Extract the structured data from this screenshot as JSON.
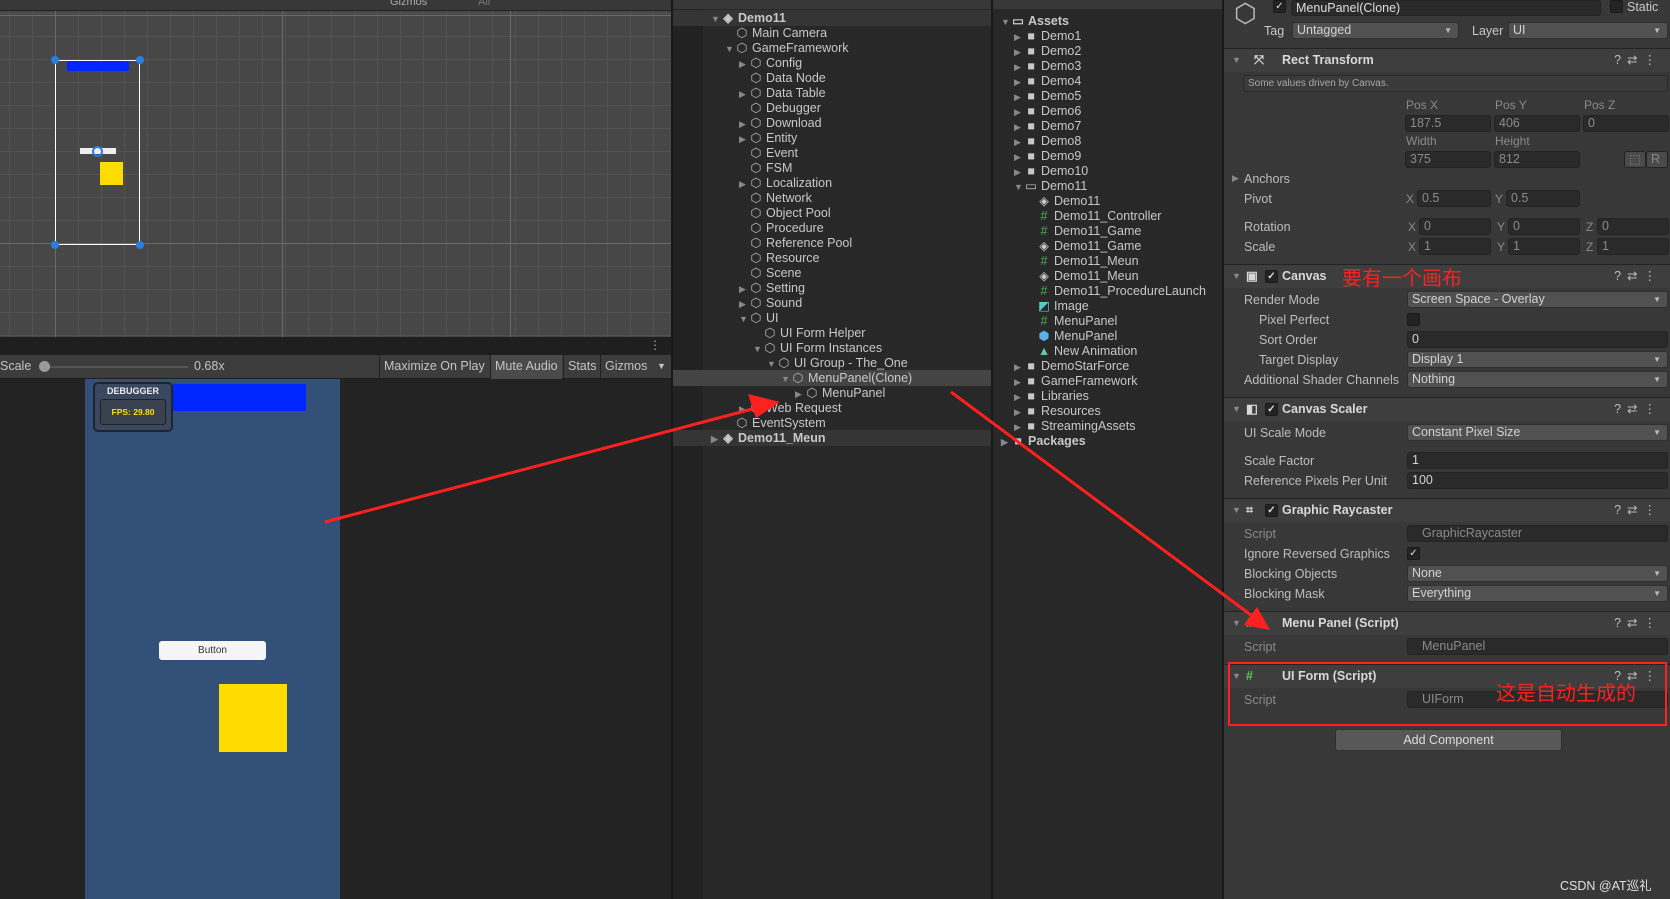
{
  "scene": {
    "toolbar": {
      "gizmos": "Gizmos",
      "search_placeholder": "All"
    }
  },
  "game_toolbar": {
    "scale_label": "Scale",
    "scale_value": "0.68x",
    "scale_fraction": 0.0,
    "maximize": "Maximize On Play",
    "mute": "Mute Audio",
    "stats": "Stats",
    "gizmos": "Gizmos"
  },
  "game": {
    "debugger_title": "DEBUGGER",
    "fps": "FPS: 29.80",
    "button_label": "Button",
    "colors": {
      "background": "#325078",
      "bar": "#0026ff",
      "square": "#ffdc00"
    }
  },
  "hierarchy": {
    "items": [
      {
        "label": "Demo11",
        "depth": 0,
        "arrow": "open",
        "icon": "scene",
        "scene": true
      },
      {
        "label": "Main Camera",
        "depth": 1,
        "arrow": "none",
        "icon": "cube"
      },
      {
        "label": "GameFramework",
        "depth": 1,
        "arrow": "open",
        "icon": "cube"
      },
      {
        "label": "Config",
        "depth": 2,
        "arrow": "closed",
        "icon": "cube"
      },
      {
        "label": "Data Node",
        "depth": 2,
        "arrow": "none",
        "icon": "cube"
      },
      {
        "label": "Data Table",
        "depth": 2,
        "arrow": "closed",
        "icon": "cube"
      },
      {
        "label": "Debugger",
        "depth": 2,
        "arrow": "none",
        "icon": "cube"
      },
      {
        "label": "Download",
        "depth": 2,
        "arrow": "closed",
        "icon": "cube"
      },
      {
        "label": "Entity",
        "depth": 2,
        "arrow": "closed",
        "icon": "cube"
      },
      {
        "label": "Event",
        "depth": 2,
        "arrow": "none",
        "icon": "cube"
      },
      {
        "label": "FSM",
        "depth": 2,
        "arrow": "none",
        "icon": "cube"
      },
      {
        "label": "Localization",
        "depth": 2,
        "arrow": "closed",
        "icon": "cube"
      },
      {
        "label": "Network",
        "depth": 2,
        "arrow": "none",
        "icon": "cube"
      },
      {
        "label": "Object Pool",
        "depth": 2,
        "arrow": "none",
        "icon": "cube"
      },
      {
        "label": "Procedure",
        "depth": 2,
        "arrow": "none",
        "icon": "cube"
      },
      {
        "label": "Reference Pool",
        "depth": 2,
        "arrow": "none",
        "icon": "cube"
      },
      {
        "label": "Resource",
        "depth": 2,
        "arrow": "none",
        "icon": "cube"
      },
      {
        "label": "Scene",
        "depth": 2,
        "arrow": "none",
        "icon": "cube"
      },
      {
        "label": "Setting",
        "depth": 2,
        "arrow": "closed",
        "icon": "cube"
      },
      {
        "label": "Sound",
        "depth": 2,
        "arrow": "closed",
        "icon": "cube"
      },
      {
        "label": "UI",
        "depth": 2,
        "arrow": "open",
        "icon": "cube"
      },
      {
        "label": "UI Form Helper",
        "depth": 3,
        "arrow": "none",
        "icon": "cube"
      },
      {
        "label": "UI Form Instances",
        "depth": 3,
        "arrow": "open",
        "icon": "cube"
      },
      {
        "label": "UI Group - The_One",
        "depth": 4,
        "arrow": "open",
        "icon": "cube"
      },
      {
        "label": "MenuPanel(Clone)",
        "depth": 5,
        "arrow": "open",
        "icon": "cube",
        "selected": true
      },
      {
        "label": "MenuPanel",
        "depth": 6,
        "arrow": "closed",
        "icon": "cube"
      },
      {
        "label": "Web Request",
        "depth": 2,
        "arrow": "closed",
        "icon": "cube"
      },
      {
        "label": "EventSystem",
        "depth": 1,
        "arrow": "none",
        "icon": "cube"
      },
      {
        "label": "Demo11_Meun",
        "depth": 0,
        "arrow": "closed",
        "icon": "scene",
        "scene": true
      }
    ]
  },
  "project": {
    "items": [
      {
        "label": "Assets",
        "depth": 0,
        "arrow": "open",
        "icon": "folder-open",
        "bold": true
      },
      {
        "label": "Demo1",
        "depth": 1,
        "arrow": "closed",
        "icon": "folder"
      },
      {
        "label": "Demo2",
        "depth": 1,
        "arrow": "closed",
        "icon": "folder"
      },
      {
        "label": "Demo3",
        "depth": 1,
        "arrow": "closed",
        "icon": "folder"
      },
      {
        "label": "Demo4",
        "depth": 1,
        "arrow": "closed",
        "icon": "folder"
      },
      {
        "label": "Demo5",
        "depth": 1,
        "arrow": "closed",
        "icon": "folder"
      },
      {
        "label": "Demo6",
        "depth": 1,
        "arrow": "closed",
        "icon": "folder"
      },
      {
        "label": "Demo7",
        "depth": 1,
        "arrow": "closed",
        "icon": "folder"
      },
      {
        "label": "Demo8",
        "depth": 1,
        "arrow": "closed",
        "icon": "folder"
      },
      {
        "label": "Demo9",
        "depth": 1,
        "arrow": "closed",
        "icon": "folder"
      },
      {
        "label": "Demo10",
        "depth": 1,
        "arrow": "closed",
        "icon": "folder"
      },
      {
        "label": "Demo11",
        "depth": 1,
        "arrow": "open",
        "icon": "folder-open"
      },
      {
        "label": "Demo11",
        "depth": 2,
        "arrow": "none",
        "icon": "scene"
      },
      {
        "label": "Demo11_Controller",
        "depth": 2,
        "arrow": "none",
        "icon": "script"
      },
      {
        "label": "Demo11_Game",
        "depth": 2,
        "arrow": "none",
        "icon": "script"
      },
      {
        "label": "Demo11_Game",
        "depth": 2,
        "arrow": "none",
        "icon": "scene"
      },
      {
        "label": "Demo11_Meun",
        "depth": 2,
        "arrow": "none",
        "icon": "script"
      },
      {
        "label": "Demo11_Meun",
        "depth": 2,
        "arrow": "none",
        "icon": "scene"
      },
      {
        "label": "Demo11_ProcedureLaunch",
        "depth": 2,
        "arrow": "none",
        "icon": "script"
      },
      {
        "label": "Image",
        "depth": 2,
        "arrow": "none",
        "icon": "sprite"
      },
      {
        "label": "MenuPanel",
        "depth": 2,
        "arrow": "none",
        "icon": "script"
      },
      {
        "label": "MenuPanel",
        "depth": 2,
        "arrow": "none",
        "icon": "prefab"
      },
      {
        "label": "New Animation",
        "depth": 2,
        "arrow": "none",
        "icon": "animation"
      },
      {
        "label": "DemoStarForce",
        "depth": 1,
        "arrow": "closed",
        "icon": "folder"
      },
      {
        "label": "GameFramework",
        "depth": 1,
        "arrow": "closed",
        "icon": "folder"
      },
      {
        "label": "Libraries",
        "depth": 1,
        "arrow": "closed",
        "icon": "folder"
      },
      {
        "label": "Resources",
        "depth": 1,
        "arrow": "closed",
        "icon": "folder"
      },
      {
        "label": "StreamingAssets",
        "depth": 1,
        "arrow": "closed",
        "icon": "folder"
      },
      {
        "label": "Packages",
        "depth": 0,
        "arrow": "closed",
        "icon": "folder",
        "bold": true
      }
    ]
  },
  "inspector": {
    "object_name": "MenuPanel(Clone)",
    "static_label": "Static",
    "tag_label": "Tag",
    "tag_value": "Untagged",
    "layer_label": "Layer",
    "layer_value": "UI",
    "rect": {
      "title": "Rect Transform",
      "note": "Some values driven by Canvas.",
      "posx_l": "Pos X",
      "posy_l": "Pos Y",
      "posz_l": "Pos Z",
      "posx": "187.5",
      "posy": "406",
      "posz": "0",
      "width_l": "Width",
      "height_l": "Height",
      "width": "375",
      "height": "812",
      "r": "R",
      "anchors": "Anchors",
      "pivot": "Pivot",
      "pivot_x": "0.5",
      "pivot_y": "0.5",
      "rotation": "Rotation",
      "rot_x": "0",
      "rot_y": "0",
      "rot_z": "0",
      "scale": "Scale",
      "sc_x": "1",
      "sc_y": "1",
      "sc_z": "1",
      "x": "X",
      "y": "Y",
      "z": "Z"
    },
    "canvas": {
      "title": "Canvas",
      "render_mode_l": "Render Mode",
      "render_mode": "Screen Space - Overlay",
      "pixel_perfect_l": "Pixel Perfect",
      "sort_order_l": "Sort Order",
      "sort_order": "0",
      "target_display_l": "Target Display",
      "target_display": "Display 1",
      "shader_l": "Additional Shader Channels",
      "shader": "Nothing"
    },
    "scaler": {
      "title": "Canvas Scaler",
      "mode_l": "UI Scale Mode",
      "mode": "Constant Pixel Size",
      "factor_l": "Scale Factor",
      "factor": "1",
      "ref_l": "Reference Pixels Per Unit",
      "ref": "100"
    },
    "raycaster": {
      "title": "Graphic Raycaster",
      "script_l": "Script",
      "script": "GraphicRaycaster",
      "ignore_l": "Ignore Reversed Graphics",
      "blocking_l": "Blocking Objects",
      "blocking": "None",
      "mask_l": "Blocking Mask",
      "mask": "Everything"
    },
    "menupanel": {
      "title": "Menu Panel (Script)",
      "script_l": "Script",
      "script": "MenuPanel"
    },
    "uiform": {
      "title": "UI Form (Script)",
      "script_l": "Script",
      "script": "UIForm"
    },
    "add_component": "Add Component"
  },
  "annotations": {
    "canvas_note": "要有一个画布",
    "auto_note": "这是自动生成的",
    "color": "#ff2020"
  },
  "watermark": "CSDN @AT巡礼"
}
